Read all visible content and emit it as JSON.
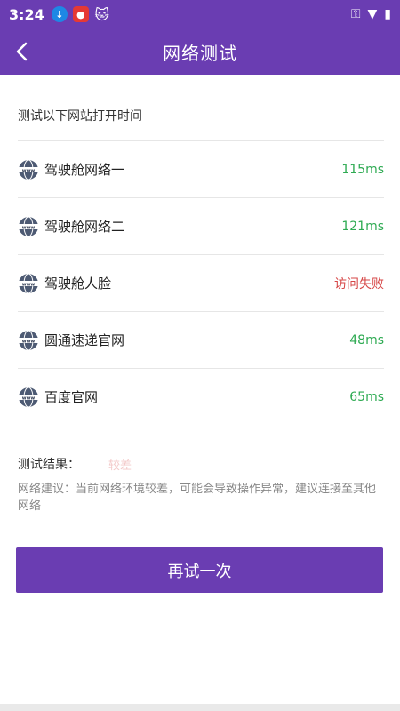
{
  "status": {
    "time": "3:24",
    "icons": [
      "download-icon",
      "app-icon",
      "cat-icon",
      "key-icon",
      "wifi-icon",
      "battery-icon"
    ]
  },
  "header": {
    "title": "网络测试"
  },
  "intro": "测试以下网站打开时间",
  "sites": [
    {
      "label": "驾驶舱网络一",
      "value": "115ms",
      "status": "ok"
    },
    {
      "label": "驾驶舱网络二",
      "value": "121ms",
      "status": "ok"
    },
    {
      "label": "驾驶舱人脸",
      "value": "访问失败",
      "status": "fail"
    },
    {
      "label": "圆通速递官网",
      "value": "48ms",
      "status": "ok"
    },
    {
      "label": "百度官网",
      "value": "65ms",
      "status": "ok"
    }
  ],
  "result": {
    "label": "测试结果：",
    "value": "较差"
  },
  "advice": "网络建议：当前网络环境较差，可能会导致操作异常，建议连接至其他网络",
  "retry_label": "再试一次",
  "colors": {
    "brand": "#6a3db2",
    "ok": "#2eaa52",
    "fail": "#d64545"
  }
}
